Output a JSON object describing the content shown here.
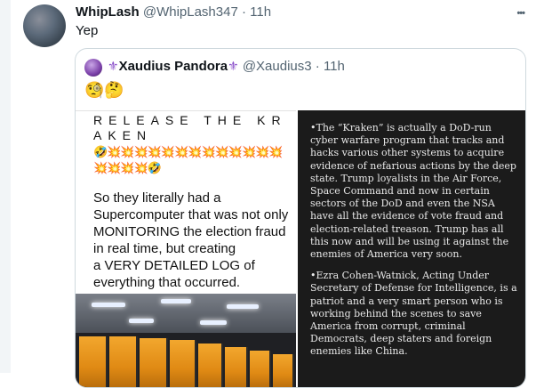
{
  "tweet": {
    "author_name": "WhipLash",
    "author_handle": "@WhipLash347",
    "separator": "·",
    "time": "11h",
    "more_icon": "•••",
    "text": "Yep"
  },
  "quoted": {
    "author_prefix_icon": "⚜",
    "author_name": "Xaudius Pandora",
    "author_suffix_icon": "⚜",
    "author_handle": "@Xaudius3",
    "separator": "·",
    "time": "11h",
    "emojis": "🧐🤔",
    "left_image": {
      "title": "RELEASE THE KRAKEN",
      "emoji_row": "🤣💥💥💥💥💥💥💥💥💥💥💥💥💥💥💥💥💥🤣",
      "paragraph1": "So they literally had a Supercomputer that was not only MONITORING the election fraud in real time, but creating",
      "paragraph2": "a VERY DETAILED LOG of everything that occurred."
    },
    "right_image": {
      "paragraph1": "•The “Kraken” is actually a DoD-run cyber warfare program that tracks and hacks various other systems to acquire evidence of nefarious actions by the deep state. Trump loyalists in the Air Force, Space Command and now in certain sectors of the DoD and even the NSA have all the evidence of vote fraud and election-related treason. Trump has all this now and will be using it against the enemies of America very soon.",
      "paragraph2": "•Ezra Cohen-Watnick, Acting Under Secretary of Defense for Intelligence, is a patriot and a very smart person who is working behind the scenes to save America from corrupt, criminal Democrats, deep staters and foreign enemies like China."
    }
  }
}
